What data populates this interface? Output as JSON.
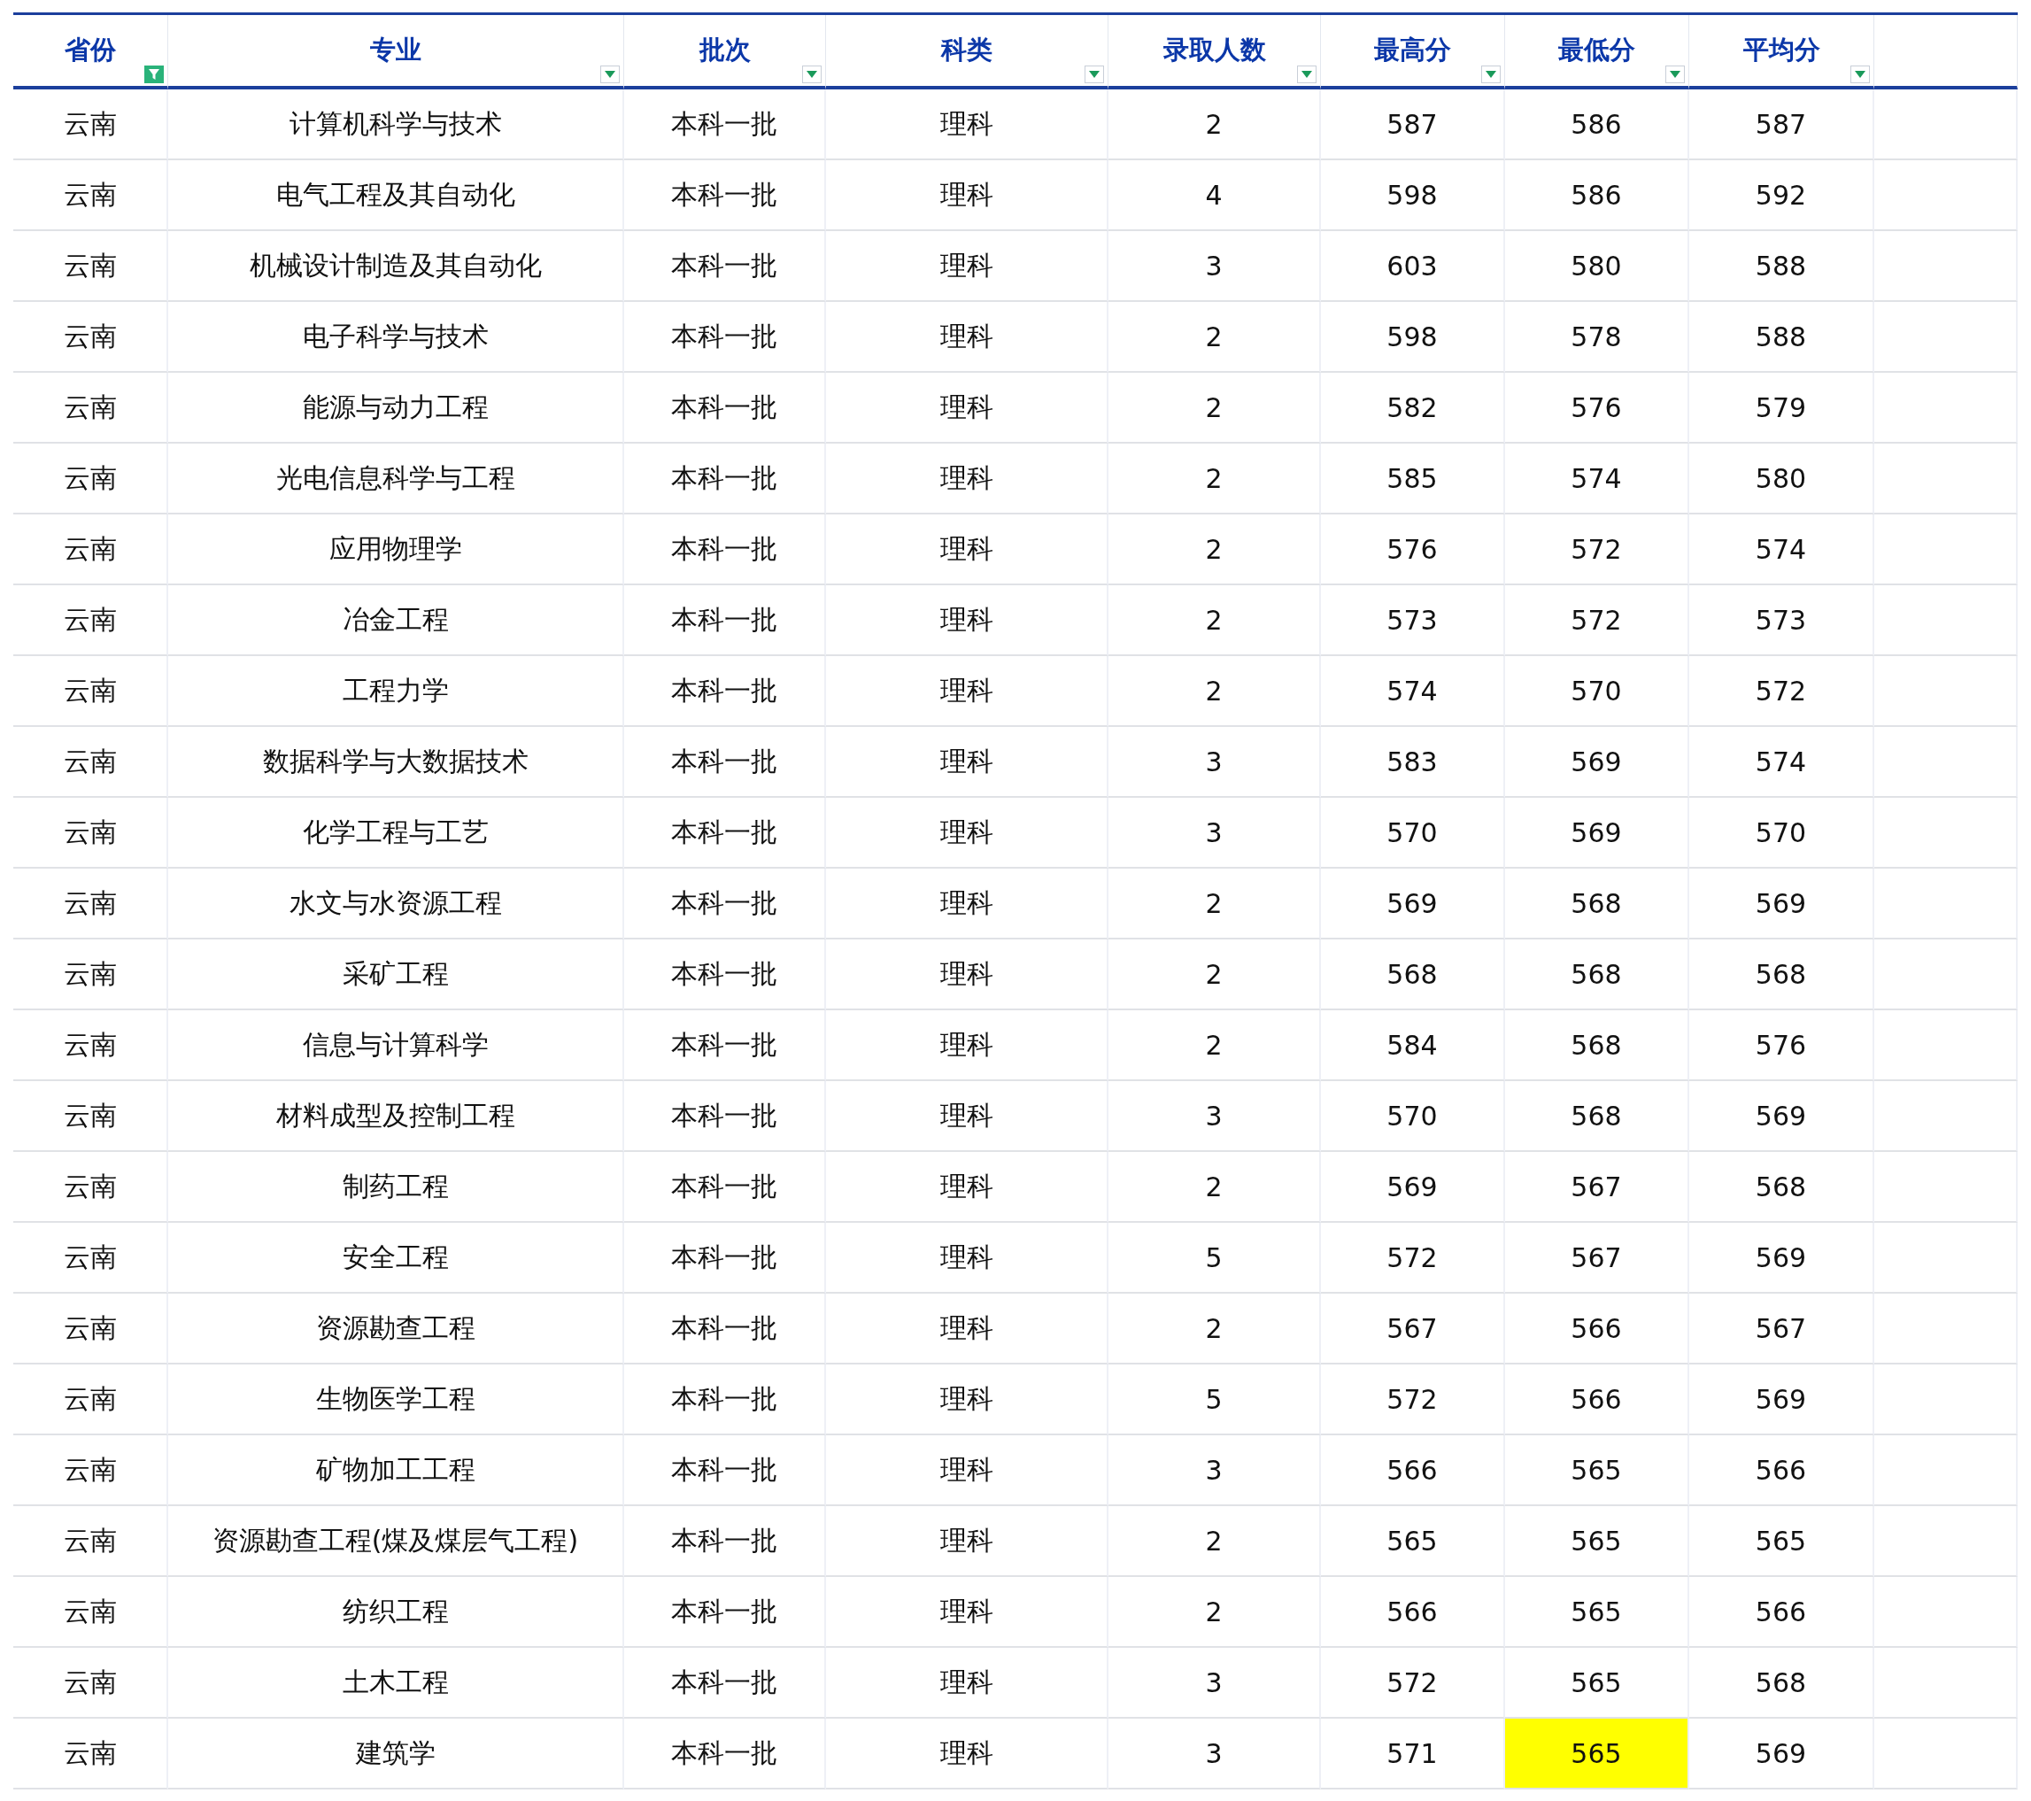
{
  "table": {
    "columns": [
      {
        "label": "省份",
        "filter_active": true
      },
      {
        "label": "专业",
        "filter_active": false
      },
      {
        "label": "批次",
        "filter_active": false
      },
      {
        "label": "科类",
        "filter_active": false
      },
      {
        "label": "录取人数",
        "filter_active": false
      },
      {
        "label": "最高分",
        "filter_active": false
      },
      {
        "label": "最低分",
        "filter_active": false
      },
      {
        "label": "平均分",
        "filter_active": false
      }
    ],
    "rows": [
      {
        "cells": [
          "云南",
          "计算机科学与技术",
          "本科一批",
          "理科",
          "2",
          "587",
          "586",
          "587"
        ],
        "min_highlighted": false
      },
      {
        "cells": [
          "云南",
          "电气工程及其自动化",
          "本科一批",
          "理科",
          "4",
          "598",
          "586",
          "592"
        ],
        "min_highlighted": false
      },
      {
        "cells": [
          "云南",
          "机械设计制造及其自动化",
          "本科一批",
          "理科",
          "3",
          "603",
          "580",
          "588"
        ],
        "min_highlighted": false
      },
      {
        "cells": [
          "云南",
          "电子科学与技术",
          "本科一批",
          "理科",
          "2",
          "598",
          "578",
          "588"
        ],
        "min_highlighted": false
      },
      {
        "cells": [
          "云南",
          "能源与动力工程",
          "本科一批",
          "理科",
          "2",
          "582",
          "576",
          "579"
        ],
        "min_highlighted": false
      },
      {
        "cells": [
          "云南",
          "光电信息科学与工程",
          "本科一批",
          "理科",
          "2",
          "585",
          "574",
          "580"
        ],
        "min_highlighted": false
      },
      {
        "cells": [
          "云南",
          "应用物理学",
          "本科一批",
          "理科",
          "2",
          "576",
          "572",
          "574"
        ],
        "min_highlighted": false
      },
      {
        "cells": [
          "云南",
          "冶金工程",
          "本科一批",
          "理科",
          "2",
          "573",
          "572",
          "573"
        ],
        "min_highlighted": false
      },
      {
        "cells": [
          "云南",
          "工程力学",
          "本科一批",
          "理科",
          "2",
          "574",
          "570",
          "572"
        ],
        "min_highlighted": false
      },
      {
        "cells": [
          "云南",
          "数据科学与大数据技术",
          "本科一批",
          "理科",
          "3",
          "583",
          "569",
          "574"
        ],
        "min_highlighted": false
      },
      {
        "cells": [
          "云南",
          "化学工程与工艺",
          "本科一批",
          "理科",
          "3",
          "570",
          "569",
          "570"
        ],
        "min_highlighted": false
      },
      {
        "cells": [
          "云南",
          "水文与水资源工程",
          "本科一批",
          "理科",
          "2",
          "569",
          "568",
          "569"
        ],
        "min_highlighted": false
      },
      {
        "cells": [
          "云南",
          "采矿工程",
          "本科一批",
          "理科",
          "2",
          "568",
          "568",
          "568"
        ],
        "min_highlighted": false
      },
      {
        "cells": [
          "云南",
          "信息与计算科学",
          "本科一批",
          "理科",
          "2",
          "584",
          "568",
          "576"
        ],
        "min_highlighted": false
      },
      {
        "cells": [
          "云南",
          "材料成型及控制工程",
          "本科一批",
          "理科",
          "3",
          "570",
          "568",
          "569"
        ],
        "min_highlighted": false
      },
      {
        "cells": [
          "云南",
          "制药工程",
          "本科一批",
          "理科",
          "2",
          "569",
          "567",
          "568"
        ],
        "min_highlighted": false
      },
      {
        "cells": [
          "云南",
          "安全工程",
          "本科一批",
          "理科",
          "5",
          "572",
          "567",
          "569"
        ],
        "min_highlighted": false
      },
      {
        "cells": [
          "云南",
          "资源勘查工程",
          "本科一批",
          "理科",
          "2",
          "567",
          "566",
          "567"
        ],
        "min_highlighted": false
      },
      {
        "cells": [
          "云南",
          "生物医学工程",
          "本科一批",
          "理科",
          "5",
          "572",
          "566",
          "569"
        ],
        "min_highlighted": false
      },
      {
        "cells": [
          "云南",
          "矿物加工工程",
          "本科一批",
          "理科",
          "3",
          "566",
          "565",
          "566"
        ],
        "min_highlighted": false
      },
      {
        "cells": [
          "云南",
          "资源勘查工程(煤及煤层气工程)",
          "本科一批",
          "理科",
          "2",
          "565",
          "565",
          "565"
        ],
        "min_highlighted": false
      },
      {
        "cells": [
          "云南",
          "纺织工程",
          "本科一批",
          "理科",
          "2",
          "566",
          "565",
          "566"
        ],
        "min_highlighted": false
      },
      {
        "cells": [
          "云南",
          "土木工程",
          "本科一批",
          "理科",
          "3",
          "572",
          "565",
          "568"
        ],
        "min_highlighted": false
      },
      {
        "cells": [
          "云南",
          "建筑学",
          "本科一批",
          "理科",
          "3",
          "571",
          "565",
          "569"
        ],
        "min_highlighted": true
      }
    ]
  }
}
